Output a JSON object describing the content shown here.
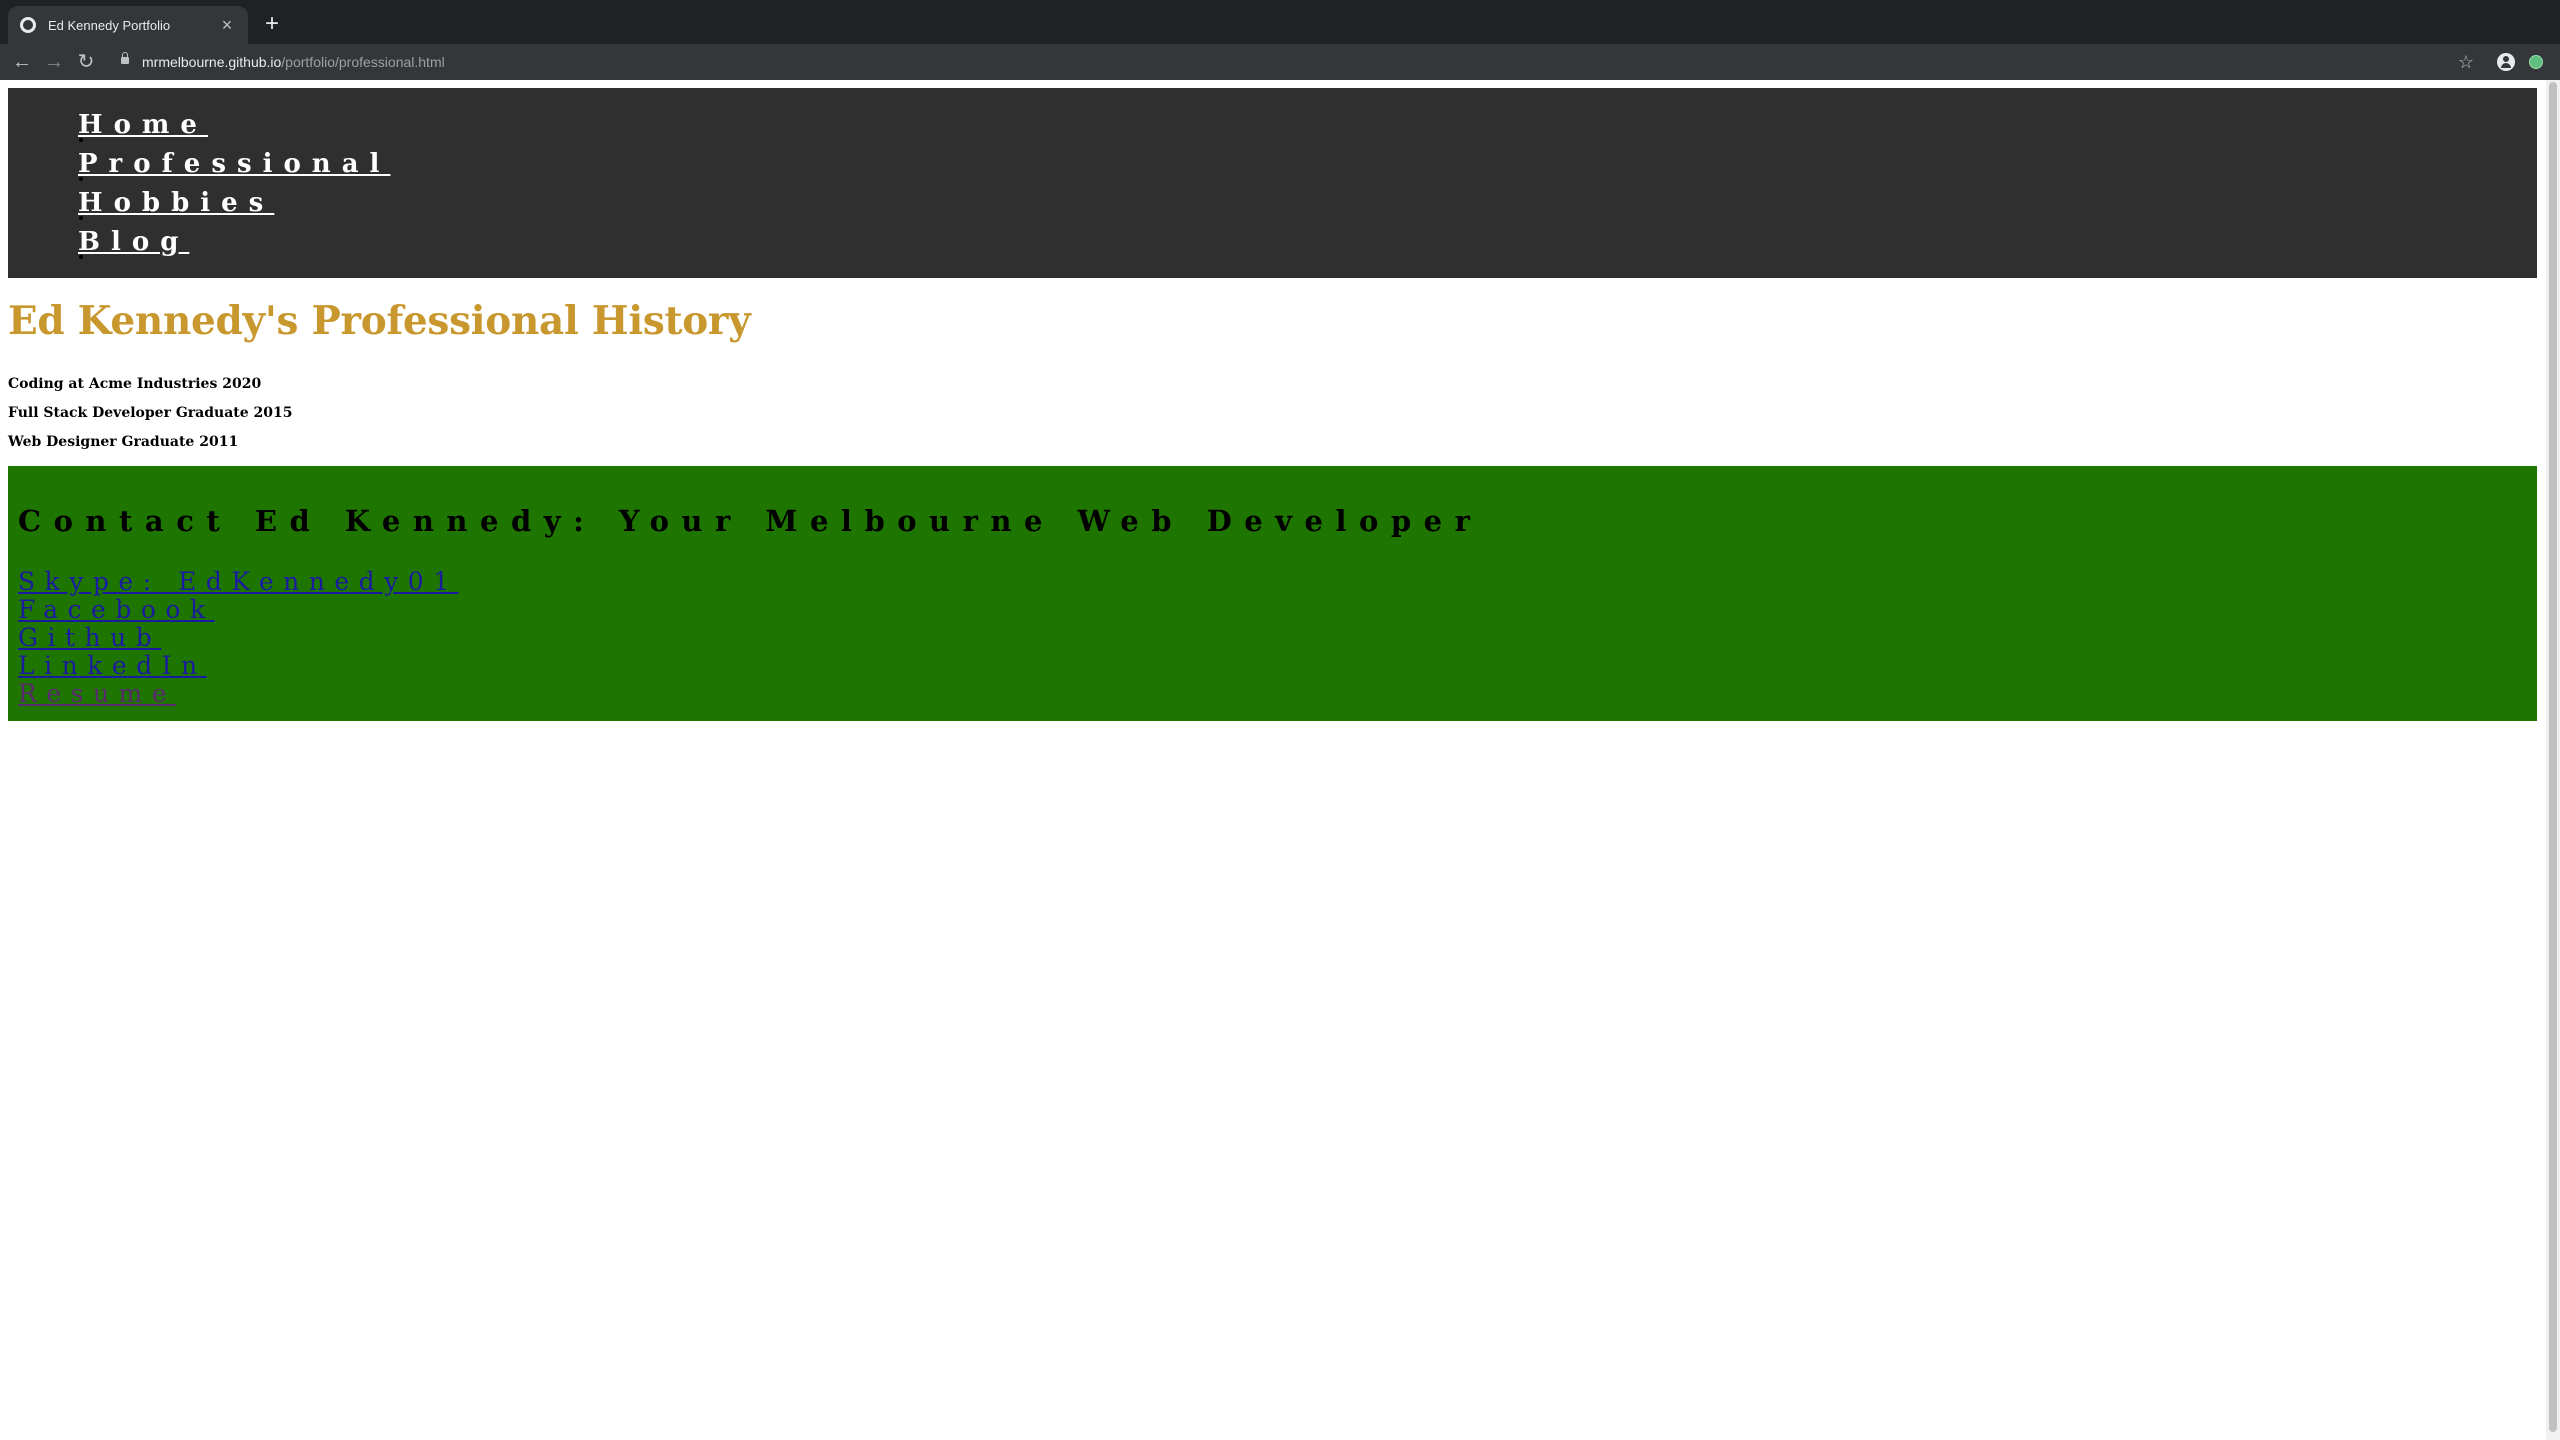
{
  "browser": {
    "tab_title": "Ed Kennedy Portfolio",
    "tab_close": "×",
    "new_tab": "+",
    "url_host": "mrmelbourne.github.io",
    "url_path": "/portfolio/professional.html",
    "back": "←",
    "forward": "→",
    "reload": "↻",
    "bookmark": "☆"
  },
  "nav": {
    "items": [
      {
        "label": "Home"
      },
      {
        "label": "Professional"
      },
      {
        "label": "Hobbies"
      },
      {
        "label": "Blog"
      }
    ]
  },
  "main": {
    "title": "Ed Kennedy's Professional History",
    "history": [
      "Coding at Acme Industries 2020",
      "Full Stack Developer Graduate 2015",
      "Web Designer Graduate 2011"
    ]
  },
  "contact": {
    "heading": "Contact Ed Kennedy: Your Melbourne Web Developer",
    "links": [
      {
        "label": "Skype: EdKennedy01"
      },
      {
        "label": "Facebook"
      },
      {
        "label": "Github"
      },
      {
        "label": "LinkedIn"
      },
      {
        "label": "Resume"
      }
    ]
  },
  "colors": {
    "nav_bg": "#2f2f2f",
    "title": "#c8982f",
    "contact_bg": "#1e7500",
    "link": "#1b1ba0",
    "visited_link": "#5a2a6e"
  }
}
